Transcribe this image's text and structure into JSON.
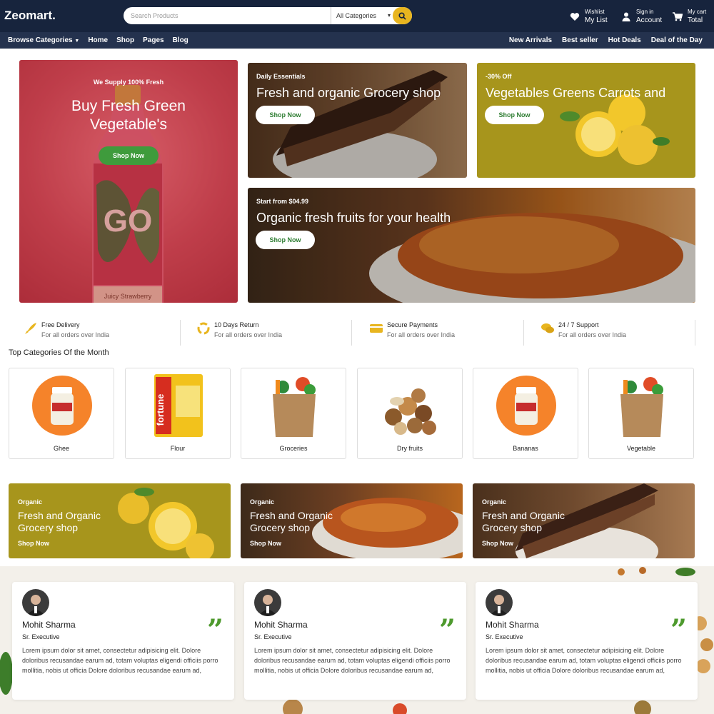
{
  "header": {
    "logo": "Zeomart.",
    "search": {
      "placeholder": "Search Products",
      "category": "All Categories"
    },
    "wishlist": {
      "line1": "Wishlist",
      "line2": "My List"
    },
    "account": {
      "line1": "Sign in",
      "line2": "Account"
    },
    "cart": {
      "line1": "My cart",
      "line2": "Total"
    }
  },
  "nav": {
    "left": [
      "Browse Categories",
      "Home",
      "Shop",
      "Pages",
      "Blog"
    ],
    "right": [
      "New Arrivals",
      "Best seller",
      "Hot Deals",
      "Deal of the Day"
    ]
  },
  "banners": {
    "main": {
      "tag": "We Supply 100% Fresh",
      "title_line1": "Buy Fresh Green",
      "title_line2": "Vegetable's",
      "button": "Shop Now",
      "bottle_text": "GO",
      "bottle_label": "Juicy Strawberry"
    },
    "b2": {
      "tag": "Daily Essentials",
      "title": "Fresh and organic Grocery shop",
      "button": "Shop Now"
    },
    "b3": {
      "tag": "-30% Off",
      "title": "Vegetables Greens Carrots and",
      "button": "Shop Now"
    },
    "b4": {
      "tag": "Start from $04.99",
      "title": "Organic fresh fruits for your health",
      "button": "Shop Now"
    }
  },
  "features": [
    {
      "title": "Free Delivery",
      "sub": "For all orders over India"
    },
    {
      "title": "10 Days Return",
      "sub": "For all orders over India"
    },
    {
      "title": "Secure Payments",
      "sub": "For all orders over India"
    },
    {
      "title": "24 / 7 Support",
      "sub": "For all orders over India"
    }
  ],
  "categories_title": "Top Categories Of the Month",
  "categories": [
    "Ghee",
    "Flour",
    "Groceries",
    "Dry fruits",
    "Bananas",
    "Vegetable"
  ],
  "flour_brand": "fortune",
  "promos": [
    {
      "tag": "Organic",
      "title": "Fresh and Organic Grocery shop",
      "link": "Shop Now"
    },
    {
      "tag": "Organic",
      "title": "Fresh and Organic Grocery shop",
      "link": "Shop Now"
    },
    {
      "tag": "Organic",
      "title": "Fresh and Organic Grocery shop",
      "link": "Shop Now"
    }
  ],
  "testimonials": [
    {
      "name": "Mohit Sharma",
      "role": "Sr. Executive",
      "text": "Lorem ipsum dolor sit amet, consectetur adipisicing elit. Dolore doloribus recusandae earum ad, totam voluptas eligendi officiis porro mollitia, nobis ut officia Dolore doloribus recusandae earum ad,"
    },
    {
      "name": "Mohit Sharma",
      "role": "Sr. Executive",
      "text": "Lorem ipsum dolor sit amet, consectetur adipisicing elit. Dolore doloribus recusandae earum ad, totam voluptas eligendi officiis porro mollitia, nobis ut officia Dolore doloribus recusandae earum ad,"
    },
    {
      "name": "Mohit Sharma",
      "role": "Sr. Executive",
      "text": "Lorem ipsum dolor sit amet, consectetur adipisicing elit. Dolore doloribus recusandae earum ad, totam voluptas eligendi officiis porro mollitia, nobis ut officia Dolore doloribus recusandae earum ad,"
    }
  ],
  "quote_mark": "”",
  "colors": {
    "header": "#17243d",
    "nav": "#24324e",
    "accent": "#e8b51f",
    "green": "#3f9b3c",
    "olive": "#a7951c"
  },
  "icons": {
    "search": "search-icon",
    "wishlist": "heart-icon",
    "account": "user-icon",
    "cart": "cart-icon",
    "delivery": "rocket-icon",
    "return": "recycle-icon",
    "payment": "card-icon",
    "support": "chat-icon",
    "quote": "quote-icon"
  }
}
